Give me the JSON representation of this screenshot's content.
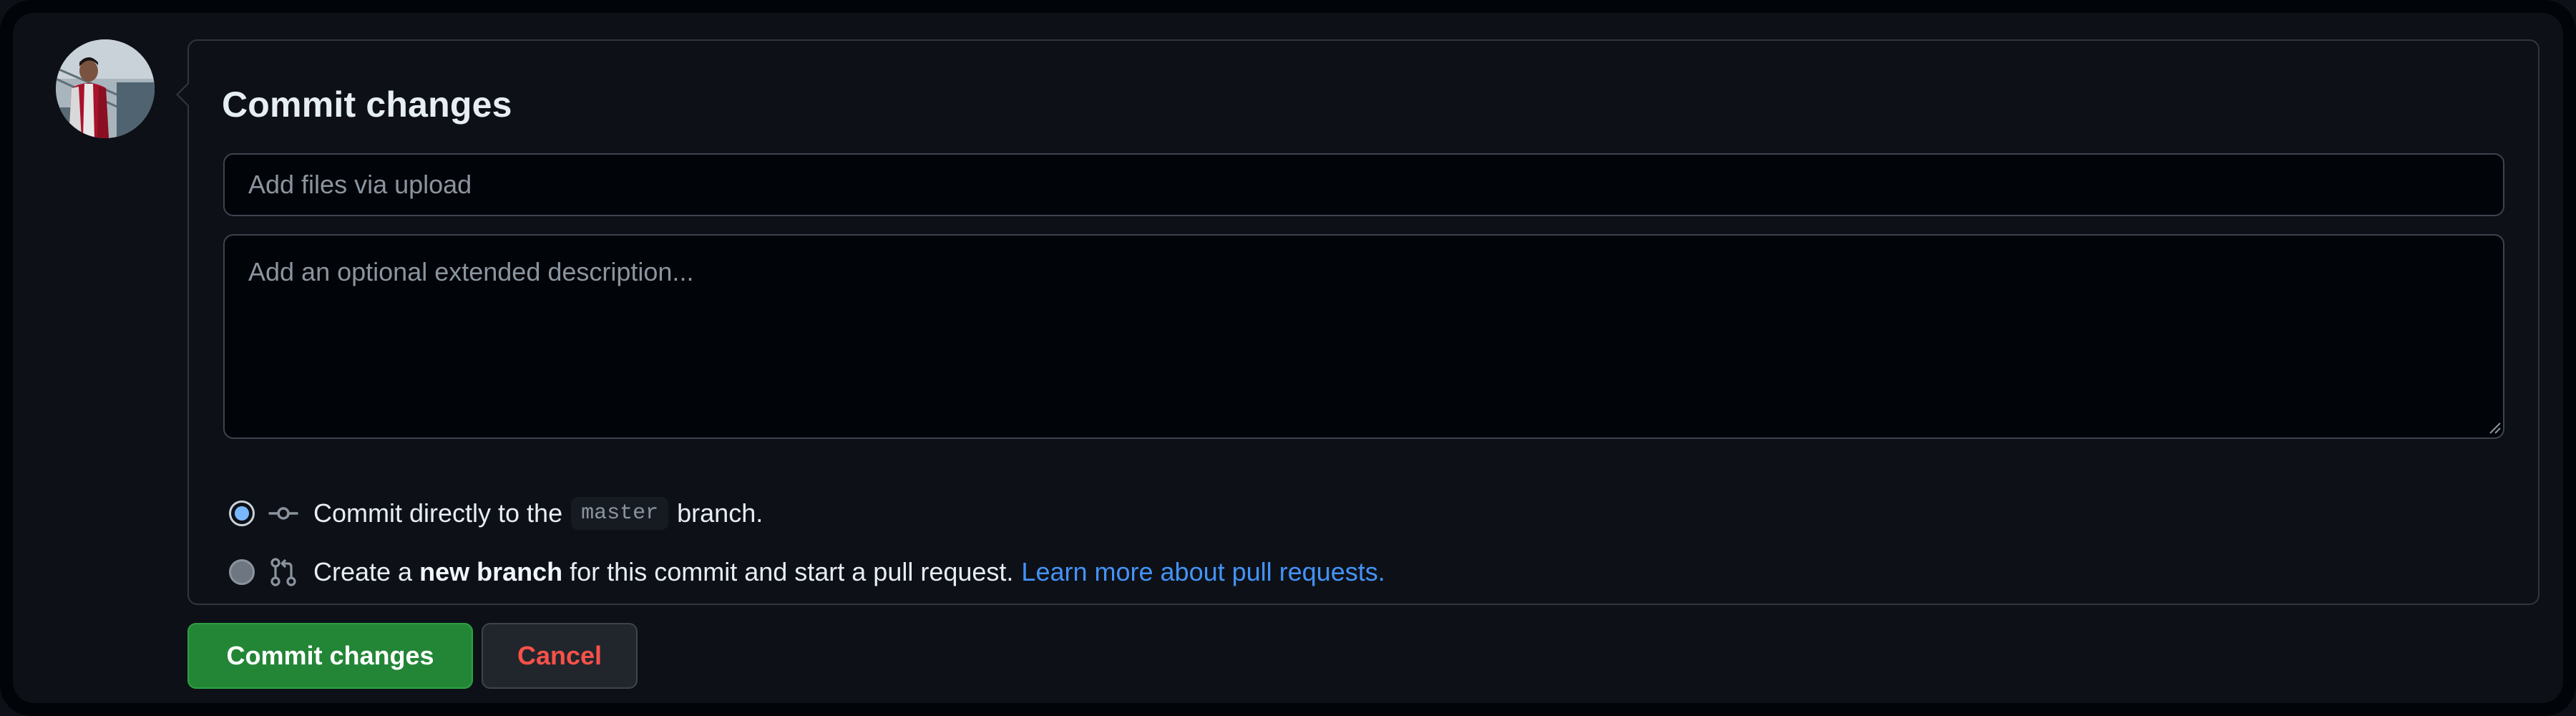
{
  "commit_form": {
    "title": "Commit changes",
    "summary_placeholder": "Add files via upload",
    "description_placeholder": "Add an optional extended description...",
    "options": [
      {
        "selected": true,
        "icon": "git-commit-icon",
        "text_before": "Commit directly to the",
        "branch": "master",
        "text_after": "branch."
      },
      {
        "selected": false,
        "icon": "git-pull-request-icon",
        "text_before": "Create a",
        "bold_text": "new branch",
        "text_after": "for this commit and start a pull request.",
        "link_text": "Learn more about pull requests."
      }
    ]
  },
  "actions": {
    "commit_label": "Commit changes",
    "cancel_label": "Cancel"
  },
  "colors": {
    "background": "#0d1117",
    "input_background": "#010409",
    "border": "#30363d",
    "primary_button": "#238636",
    "danger_text": "#f85149",
    "link": "#4493f8",
    "radio_checked": "#79b8ff"
  }
}
